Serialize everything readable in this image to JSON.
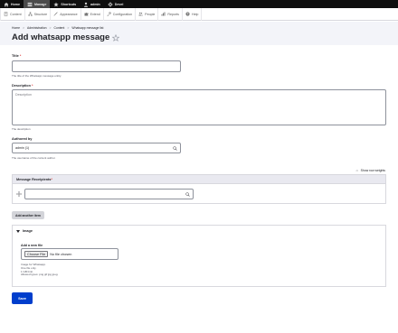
{
  "toolbar": {
    "items": [
      {
        "label": "Home",
        "icon": "home-icon"
      },
      {
        "label": "Manage",
        "icon": "manage-icon",
        "active": true
      },
      {
        "label": "Shortcuts",
        "icon": "star-icon"
      },
      {
        "label": "admin",
        "icon": "user-icon"
      },
      {
        "label": "Devel",
        "icon": "devel-icon"
      }
    ]
  },
  "admin_menu": {
    "items": [
      {
        "label": "Content",
        "icon": "content-icon"
      },
      {
        "label": "Structure",
        "icon": "structure-icon"
      },
      {
        "label": "Appearance",
        "icon": "appearance-icon"
      },
      {
        "label": "Extend",
        "icon": "extend-icon"
      },
      {
        "label": "Configuration",
        "icon": "configuration-icon"
      },
      {
        "label": "People",
        "icon": "people-icon"
      },
      {
        "label": "Reports",
        "icon": "reports-icon"
      },
      {
        "label": "Help",
        "icon": "help-icon"
      }
    ]
  },
  "breadcrumb": {
    "items": [
      "Home",
      "Administration",
      "Content",
      "Whatsapp message list"
    ],
    "separator": ">"
  },
  "page": {
    "title": "Add whatsapp message"
  },
  "form": {
    "title_field": {
      "label": "Title",
      "required_mark": "*",
      "value": "",
      "help": "The title of the Whatsapp message entity."
    },
    "description_field": {
      "label": "Description",
      "required_mark": "*",
      "placeholder": "Description",
      "help": "The description"
    },
    "authored_by": {
      "label": "Authored by",
      "value": "admin (1)",
      "help": "The username of the content author."
    },
    "row_weights_label": "Show row weights",
    "recipients": {
      "label": "Message Receipients",
      "required_mark": "*",
      "value": ""
    },
    "add_another_label": "Add another item",
    "image": {
      "summary": "Image",
      "add_file_label": "Add a new file",
      "choose_button": "Choose File",
      "no_file_text": "No file chosen",
      "help_lines": [
        "Image for Whatsapp.",
        "One file only.",
        "1 GB limit.",
        "Allowed types: png gif jpg jpeg."
      ]
    },
    "save_label": "Save"
  },
  "colors": {
    "toolbar_bg": "#0f0f0f",
    "primary_button": "#003ecc",
    "required": "#dc2323",
    "header_bg": "#f3f4f9"
  }
}
